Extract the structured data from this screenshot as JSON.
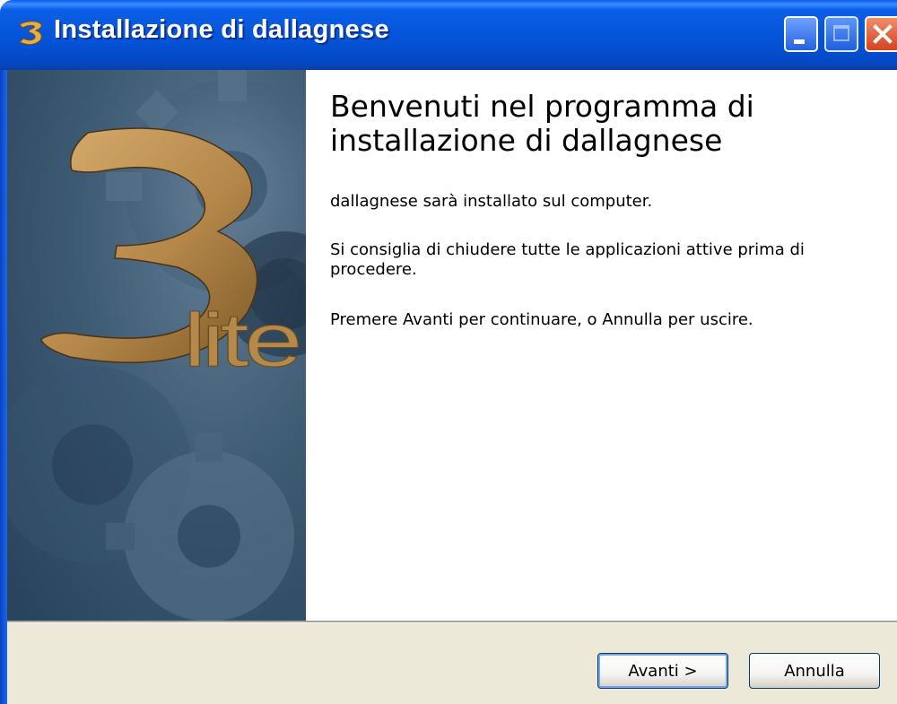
{
  "window": {
    "title": "Installazione di dallagnese",
    "title_icon": "installer-3lite-icon",
    "controls": [
      "minimize-icon",
      "maximize-icon",
      "close-icon"
    ]
  },
  "banner": {
    "logo_number": "3",
    "logo_word": "lite"
  },
  "content": {
    "heading": "Benvenuti nel programma di installazione di dallagnese",
    "paragraph1": "dallagnese sarà installato sul computer.",
    "paragraph2": "Si consiglia di chiudere tutte le applicazioni attive prima di procedere.",
    "paragraph3": "Premere Avanti per continuare, o Annulla per uscire."
  },
  "buttons": {
    "next_label": "Avanti >",
    "cancel_label": "Annulla"
  },
  "colors": {
    "titlebar": "#0554d8",
    "accent_gold": "#b88a4a",
    "footer_bg": "#ece9d8"
  }
}
